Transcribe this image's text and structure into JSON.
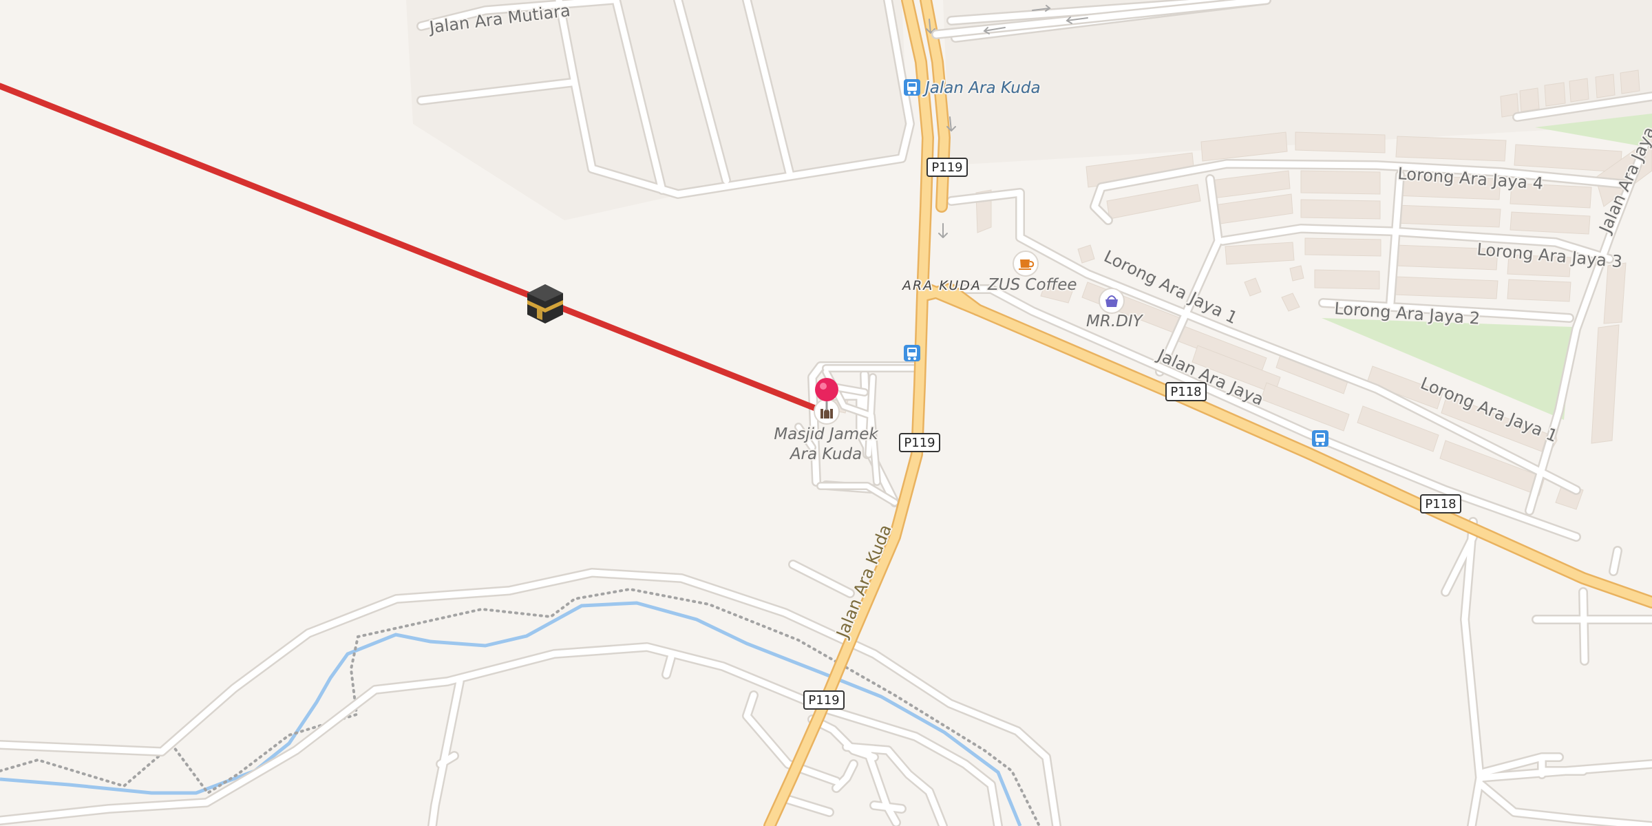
{
  "streets": {
    "jalan_ara_mutiara": "Jalan Ara Mutiara",
    "jalan_ara_kuda": "Jalan Ara Kuda",
    "lorong_ara_jaya_4": "Lorong Ara Jaya 4",
    "lorong_ara_jaya_3": "Lorong Ara Jaya 3",
    "lorong_ara_jaya_2": "Lorong Ara Jaya 2",
    "lorong_ara_jaya_1_a": "Lorong Ara Jaya 1",
    "lorong_ara_jaya_1_b": "Lorong Ara Jaya 1",
    "jalan_ara_jaya": "Jalan Ara Jaya",
    "jalan_ara_jaya_right": "Jalan Ara Jaya"
  },
  "places": {
    "bus_stop_name": "Jalan Ara Kuda",
    "area_name": "ARA KUDA",
    "coffee": "ZUS Coffee",
    "shop": "MR.DIY",
    "mosque_line1": "Masjid Jamek",
    "mosque_line2": "Ara Kuda"
  },
  "route_shields": {
    "p119_a": "P119",
    "p119_b": "P119",
    "p119_c": "P119",
    "p118_a": "P118",
    "p118_b": "P118"
  },
  "icons": {
    "qibla_marker": "kaaba-icon",
    "pin": "location-pin-icon",
    "mosque": "mosque-icon",
    "coffee": "coffee-cup-icon",
    "shop": "shopping-basket-icon",
    "bus": "bus-stop-icon"
  },
  "colors": {
    "background": "#f6f3ef",
    "qibla_line": "#d6312f",
    "major_road": "#fcd994",
    "major_road_casing": "#e9b25f",
    "minor_road": "#ffffff",
    "minor_road_casing": "#d9d4ce",
    "river": "#9cc6ee",
    "park": "#d9ebc9",
    "building": "#ede4dc",
    "bus_stop": "#3d8fe0",
    "pin": "#e8245e"
  }
}
